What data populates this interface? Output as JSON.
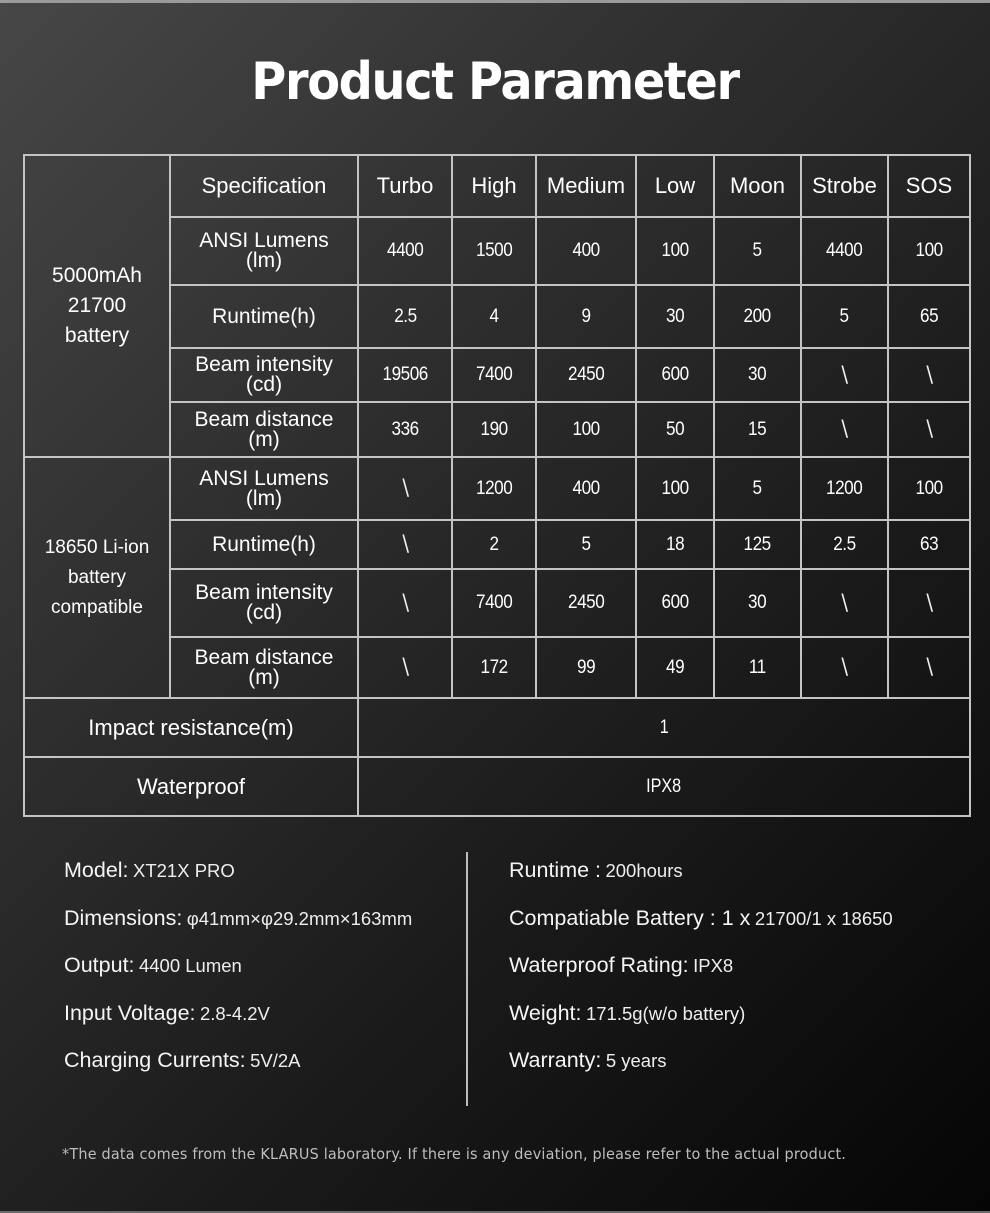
{
  "title": "Product Parameter",
  "table": {
    "header": {
      "spec_label": "Specification",
      "modes": [
        "Turbo",
        "High",
        "Medium",
        "Low",
        "Moon",
        "Strobe",
        "SOS"
      ]
    },
    "groups": [
      {
        "label_lines": [
          "5000mAh",
          "21700",
          "battery"
        ],
        "rows": [
          {
            "label_lines": [
              "ANSI Lumens",
              "(lm)"
            ],
            "values": [
              "4400",
              "1500",
              "400",
              "100",
              "5",
              "4400",
              "100"
            ]
          },
          {
            "label_lines": [
              "Runtime(h)"
            ],
            "values": [
              "2.5",
              "4",
              "9",
              "30",
              "200",
              "5",
              "65"
            ]
          },
          {
            "label_lines": [
              "Beam intensity",
              "(cd)"
            ],
            "values": [
              "19506",
              "7400",
              "2450",
              "600",
              "30",
              "\\",
              "\\"
            ]
          },
          {
            "label_lines": [
              "Beam distance",
              "(m)"
            ],
            "values": [
              "336",
              "190",
              "100",
              "50",
              "15",
              "\\",
              "\\"
            ]
          }
        ]
      },
      {
        "label_lines": [
          "18650 Li-ion",
          "battery",
          "compatible"
        ],
        "rows": [
          {
            "label_lines": [
              "ANSI Lumens",
              "(lm)"
            ],
            "values": [
              "\\",
              "1200",
              "400",
              "100",
              "5",
              "1200",
              "100"
            ]
          },
          {
            "label_lines": [
              "Runtime(h)"
            ],
            "values": [
              "\\",
              "2",
              "5",
              "18",
              "125",
              "2.5",
              "63"
            ]
          },
          {
            "label_lines": [
              "Beam intensity",
              "(cd)"
            ],
            "values": [
              "\\",
              "7400",
              "2450",
              "600",
              "30",
              "\\",
              "\\"
            ]
          },
          {
            "label_lines": [
              "Beam distance",
              "(m)"
            ],
            "values": [
              "\\",
              "172",
              "99",
              "49",
              "11",
              "\\",
              "\\"
            ]
          }
        ]
      }
    ],
    "wide_rows": [
      {
        "label": "Impact resistance(m)",
        "value": "1"
      },
      {
        "label": "Waterproof",
        "value": "IPX8"
      }
    ]
  },
  "info": {
    "left": [
      {
        "key": "Model:",
        "value": "XT21X  PRO"
      },
      {
        "key": "Dimensions:",
        "value": "φ41mm×φ29.2mm×163mm"
      },
      {
        "key": "Output:",
        "value": "4400 Lumen"
      },
      {
        "key": "Input  Voltage:",
        "value": "2.8-4.2V"
      },
      {
        "key": "Charging Currents:",
        "value": "5V/2A"
      }
    ],
    "right": [
      {
        "key": "Runtime  :",
        "value": "200hours"
      },
      {
        "key": "Compatiable Battery : 1 x",
        "value": "21700/1 x 18650"
      },
      {
        "key": "Waterproof Rating:",
        "value": "IPX8"
      },
      {
        "key": "Weight:",
        "value": "171.5g(w/o battery)"
      },
      {
        "key": "Warranty:",
        "value": "5 years"
      }
    ]
  },
  "footnote": "*The data comes from the KLARUS laboratory. If there is any deviation, please refer to the actual product."
}
